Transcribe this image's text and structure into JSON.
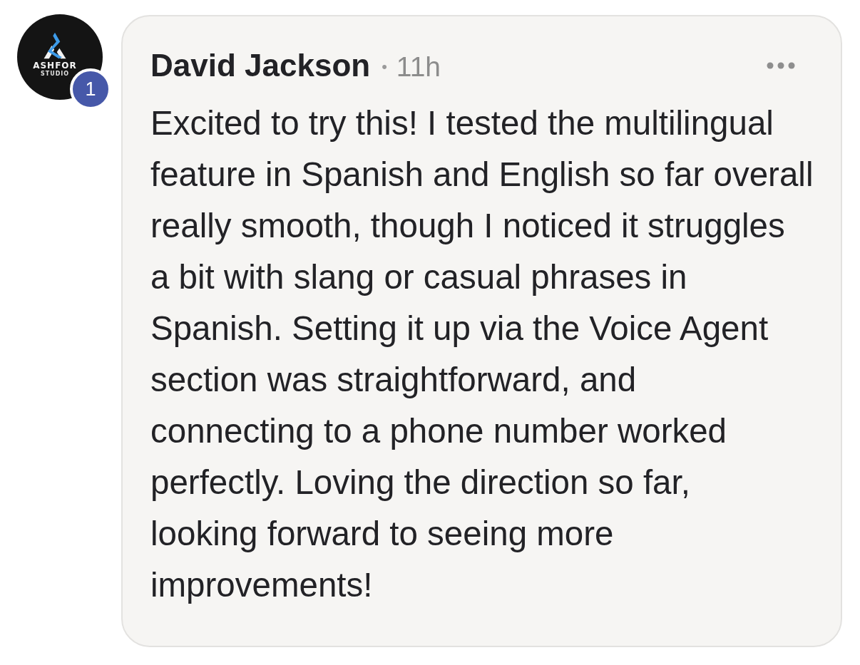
{
  "comment": {
    "avatar": {
      "logo_text": "ASHFOR",
      "logo_subtext": "STUDIO",
      "badge": "1"
    },
    "author": "David Jackson",
    "separator": "•",
    "time": "11h",
    "body": "Excited to try this! I tested the multilingual\nfeature in Spanish and English so far overall\nreally smooth, though I noticed it struggles\na bit with slang or casual phrases in\nSpanish. Setting it up via the Voice Agent\nsection was straightforward, and\nconnecting to a phone number worked\nperfectly. Loving the direction so far,\nlooking forward to seeing more\nimprovements!"
  }
}
